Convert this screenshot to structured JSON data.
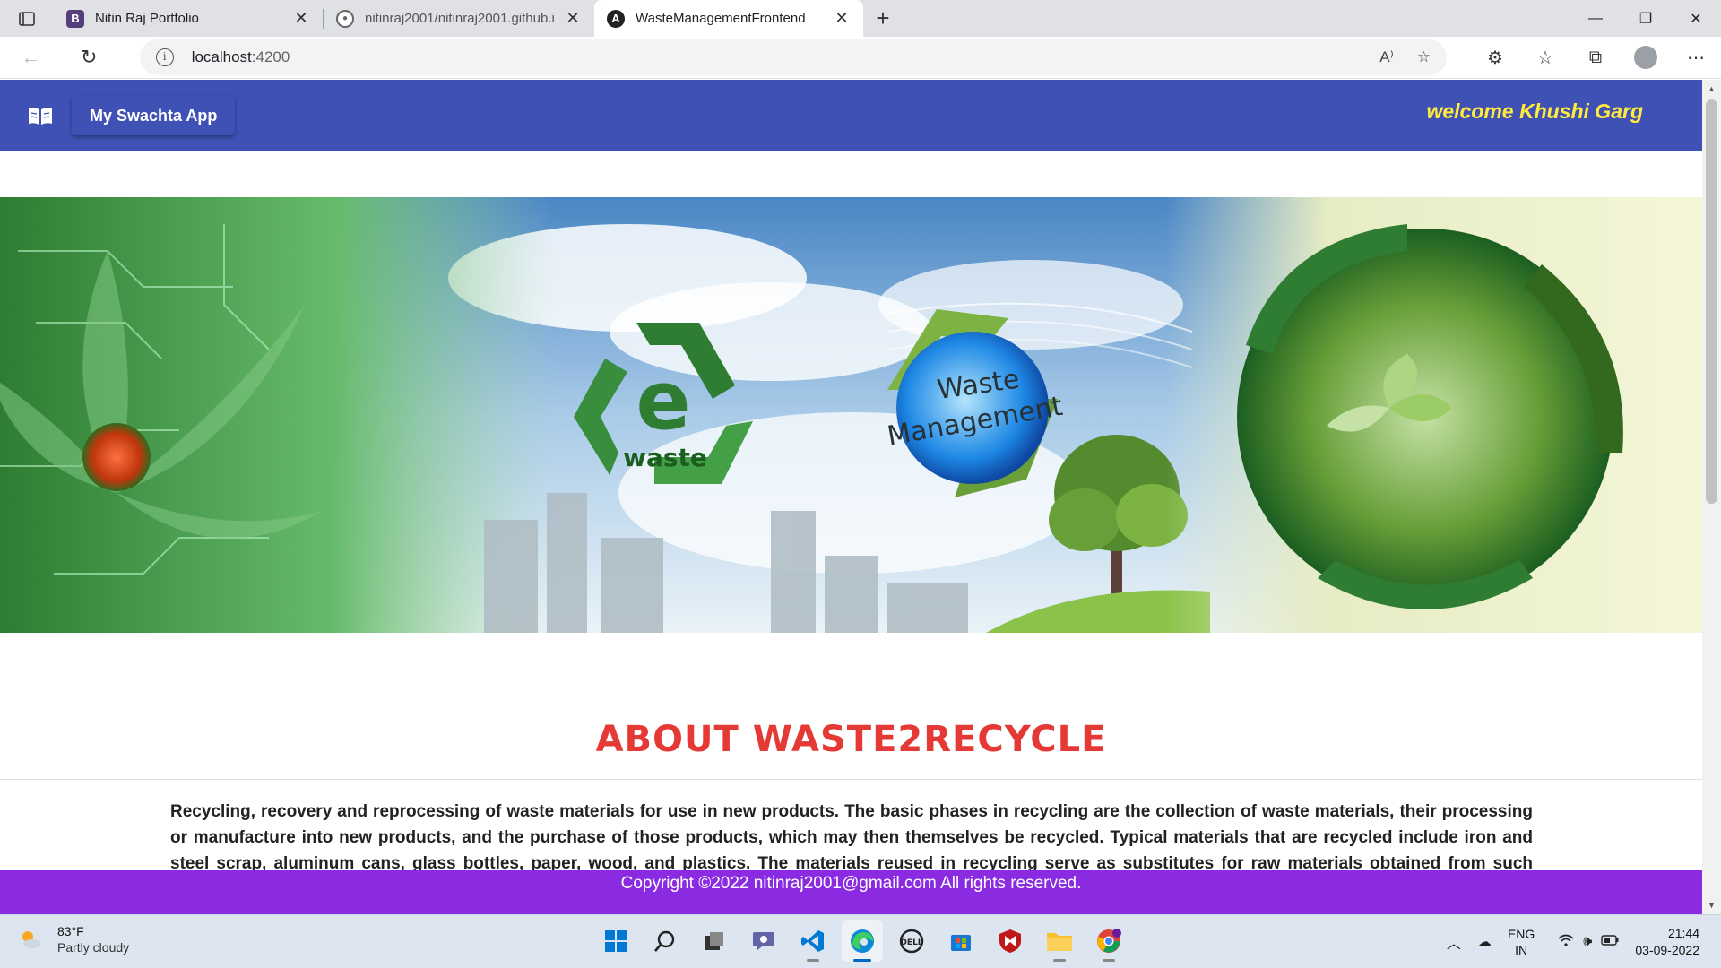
{
  "browser": {
    "tabs": [
      {
        "title": "Nitin Raj Portfolio",
        "icon": "bootstrap-icon",
        "active": false
      },
      {
        "title": "nitinraj2001/nitinraj2001.github.i",
        "icon": "github-icon",
        "active": false
      },
      {
        "title": "WasteManagementFrontend",
        "icon": "angular-icon",
        "active": true
      }
    ],
    "url_host": "localhost",
    "url_port": ":4200"
  },
  "app": {
    "brand_label": "My Swachta App",
    "welcome_text": "welcome Khushi Garg",
    "hero": {
      "ewaste_letter": "e",
      "ewaste_label": "waste",
      "globe_line1": "Waste",
      "globe_line2": "Management"
    },
    "about_title": "ABOUT WASTE2RECYCLE",
    "about_text": "Recycling, recovery and reprocessing of waste materials for use in new products. The basic phases in recycling are the collection of waste materials, their processing or manufacture into new products, and the purchase of those products, which may then themselves be recycled. Typical materials that are recycled include iron and steel scrap, aluminum cans, glass bottles, paper, wood, and plastics. The materials reused in recycling serve as substitutes for raw materials obtained from such increasingly",
    "footer_text": "Copyright ©2022 nitinraj2001@gmail.com All rights reserved."
  },
  "taskbar": {
    "weather_temp": "83°F",
    "weather_desc": "Partly cloudy",
    "lang_line1": "ENG",
    "lang_line2": "IN",
    "time": "21:44",
    "date": "03-09-2022"
  },
  "colors": {
    "nav_bg": "#3f51b5",
    "welcome": "#ffeb3b",
    "about_title": "#e53935",
    "footer_bg": "#8a2be2"
  }
}
